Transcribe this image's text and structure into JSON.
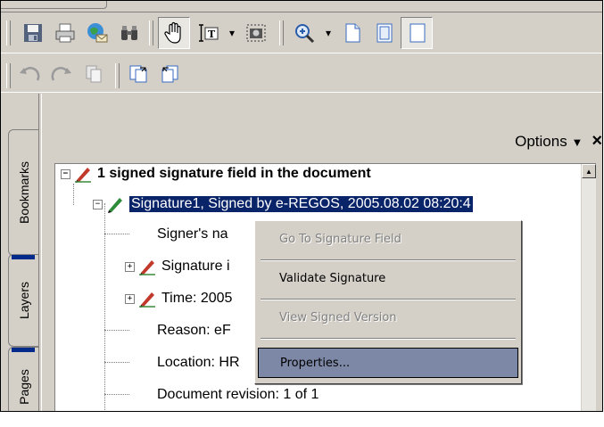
{
  "panel": {
    "options_label": "Options",
    "close_label": "×"
  },
  "side_tabs": [
    "Bookmarks",
    "Layers",
    "Pages"
  ],
  "tree": {
    "root": "1 signed signature field in the document",
    "signature": "Signature1, Signed by e-REGOS, 2005.08.02 08:20:4",
    "signer": "Signer's na",
    "sig_info": "Signature i",
    "time": "Time: 2005",
    "reason": "Reason: eF",
    "location": "Location: HR",
    "revision": "Document revision: 1 of 1"
  },
  "context_menu": {
    "items": [
      {
        "label": "Go To Signature Field",
        "state": "disabled"
      },
      {
        "label": "Validate Signature",
        "state": "enabled"
      },
      {
        "label": "View Signed Version",
        "state": "disabled"
      },
      {
        "label": "Properties...",
        "state": "highlighted"
      }
    ]
  },
  "icons": {
    "toolbar_row1": [
      "save-icon",
      "print-icon",
      "email-icon",
      "find-icon",
      "hand-tool-icon",
      "select-text-icon",
      "snapshot-icon",
      "zoom-in-icon",
      "single-page-icon",
      "continuous-page-icon"
    ],
    "toolbar_row2": [
      "rotate-left-icon",
      "rotate-right-icon",
      "copy-icon",
      "extract-page-icon",
      "insert-page-icon"
    ]
  },
  "colors": {
    "chrome": "#d4d0c8",
    "selection": "#0a246a",
    "menu_highlight": "#7d87a6",
    "tab_marker": "#002b8a"
  }
}
